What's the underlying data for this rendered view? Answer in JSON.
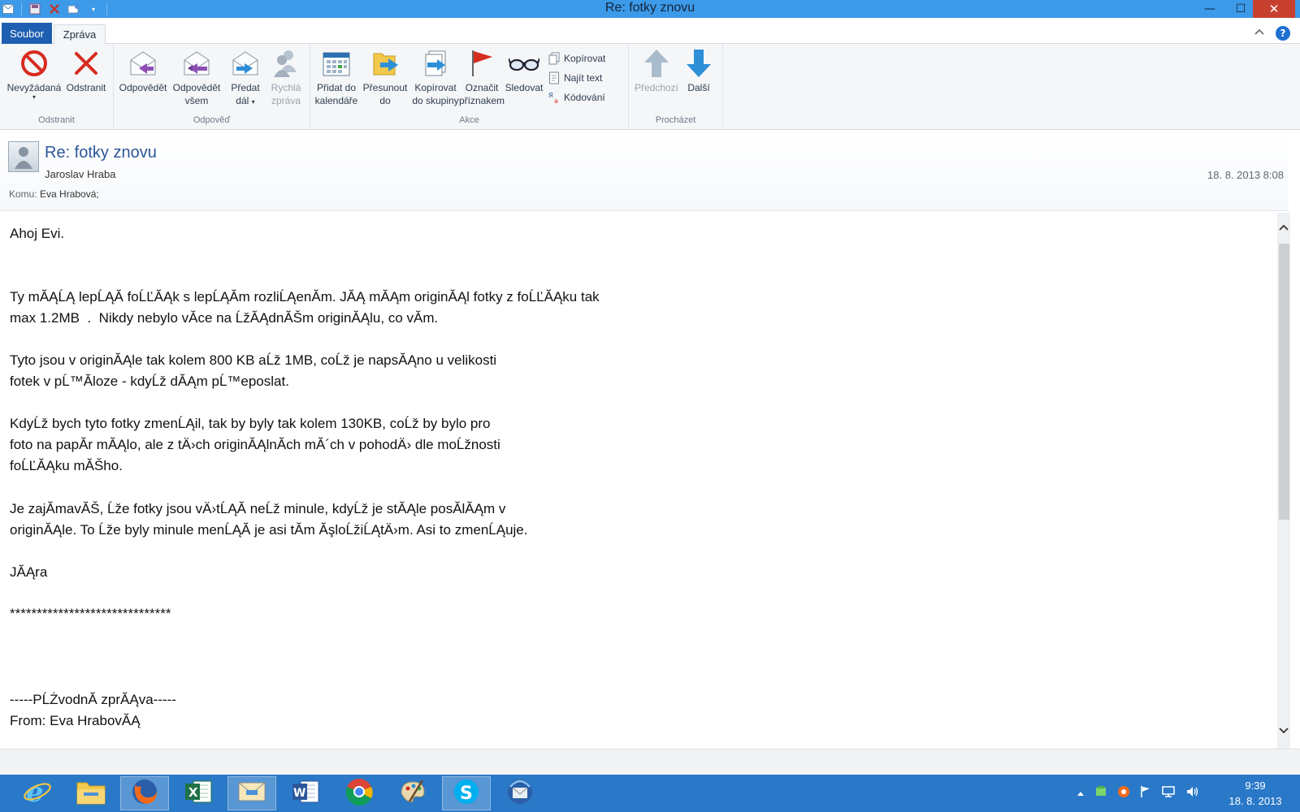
{
  "window": {
    "title": "Re: fotky znovu",
    "controls": {
      "minimize": "—",
      "maximize": "☐",
      "close": "✕"
    }
  },
  "ribbon": {
    "tabs": [
      {
        "label": "Soubor"
      },
      {
        "label": "Zpráva"
      }
    ],
    "help_label": "?",
    "groups": {
      "odstranit": {
        "label": "Odstranit",
        "junk": "Nevyžádaná",
        "delete": "Odstranit"
      },
      "odpoved": {
        "label": "Odpověď",
        "reply": "Odpovědět",
        "reply_all_1": "Odpovědět",
        "reply_all_2": "všem",
        "forward_1": "Předat",
        "forward_2": "dál",
        "im_1": "Rychlá",
        "im_2": "zpráva"
      },
      "akce": {
        "label": "Akce",
        "calendar_1": "Přidat do",
        "calendar_2": "kalendáře",
        "move_1": "Přesunout",
        "move_2": "do",
        "copy_1": "Kopírovat",
        "copy_2": "do skupiny",
        "flag_1": "Označit",
        "flag_2": "příznakem",
        "watch": "Sledovat",
        "copy_small": "Kopírovat",
        "find_text": "Najít text",
        "encoding": "Kódování"
      },
      "prochazet": {
        "label": "Procházet",
        "prev": "Předchozí",
        "next": "Další"
      }
    }
  },
  "message": {
    "subject": "Re: fotky znovu",
    "sender": "Jaroslav Hraba",
    "date": "18. 8. 2013 8:08",
    "to_label": "Komu:",
    "to_value": "Eva Hrabová;",
    "body_lines": [
      "Ahoj Evi.",
      "Ty mĂĄĹĄ lepĹĄĂ foĹĽĂĄk s lepĹĄĂm rozliĹĄenĂm. JĂĄ mĂĄm originĂĄl fotky z foĹĽĂĄku tak",
      "max 1.2MB  .  Nikdy nebylo vĂce na ĹžĂĄdnĂŠm originĂĄlu, co vĂm.",
      "Tyto jsou v originĂĄle tak kolem 800 KB aĹž 1MB, coĹž je napsĂĄno u velikosti",
      "fotek v pĹ™Ăloze - kdyĹž dĂĄm pĹ™eposlat.",
      "KdyĹž bych tyto fotky zmenĹĄil, tak by byly tak kolem 130KB, coĹž by bylo pro",
      "foto na papĂr mĂĄlo, ale z tÄ›ch originĂĄlnĂch mĂ´ch v pohodÄ› dle moĹžnosti",
      "foĹĽĂĄku mĂŠho.",
      "Je zajĂmavĂŠ, Ĺže fotky jsou vÄ›tĹĄĂ neĹž minule, kdyĹž je stĂĄle posĂlĂĄm v",
      "originĂĄle. To Ĺže byly minule menĹĄĂ je asi tĂm ĂşloĹžiĹĄtÄ›m. Asi to zmenĹĄuje.",
      "JĂĄra",
      "******************************",
      "-----PĹŻvodnĂ zprĂĄva-----",
      "From: Eva HrabovĂĄ"
    ]
  },
  "taskbar": {
    "apps": [
      {
        "name": "Internet Explorer"
      },
      {
        "name": "File Explorer"
      },
      {
        "name": "Firefox"
      },
      {
        "name": "Excel"
      },
      {
        "name": "Windows Live Mail"
      },
      {
        "name": "Word"
      },
      {
        "name": "Chrome"
      },
      {
        "name": "Paint"
      },
      {
        "name": "Skype"
      },
      {
        "name": "Thunderbird"
      }
    ],
    "clock_time": "9:39",
    "clock_date": "18. 8. 2013"
  },
  "colors": {
    "titlebar": "#3c9ae8",
    "file_tab": "#1f5fb1",
    "subject": "#2b5797",
    "close_button": "#c7402f",
    "taskbar": "#2a79c8"
  }
}
